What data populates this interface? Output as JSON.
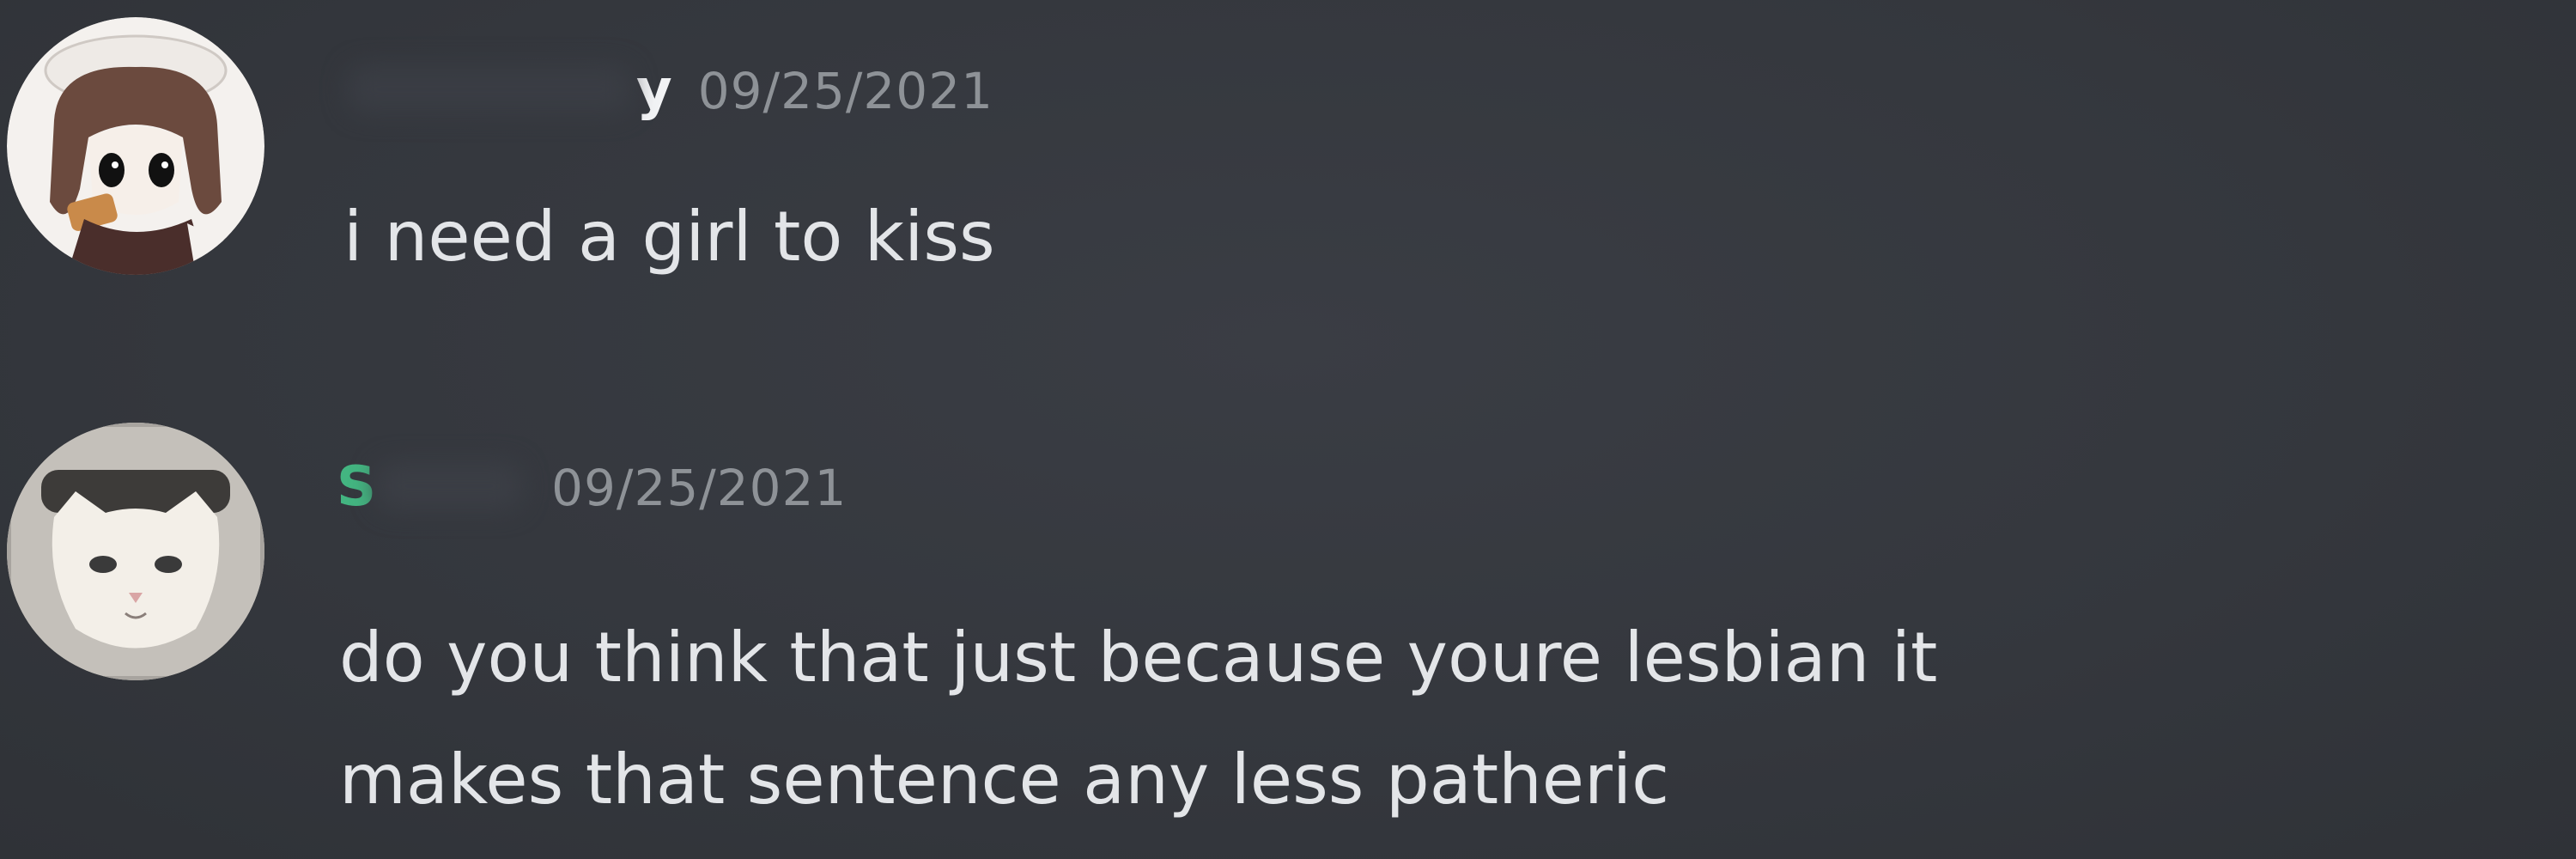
{
  "messages": [
    {
      "username": "y",
      "username_color": "#f2f3f5",
      "timestamp": "09/25/2021",
      "content": "i need a girl to kiss",
      "avatar_icon": "anime-avatar"
    },
    {
      "username": "S",
      "username_color": "#43b581",
      "timestamp": "09/25/2021",
      "content": "do you think that just because youre lesbian it\nmakes that sentence any less patheric",
      "avatar_icon": "cat-avatar"
    }
  ],
  "theme": {
    "background": "#36393f",
    "text": "#dcddde",
    "timestamp": "#8e9297"
  }
}
